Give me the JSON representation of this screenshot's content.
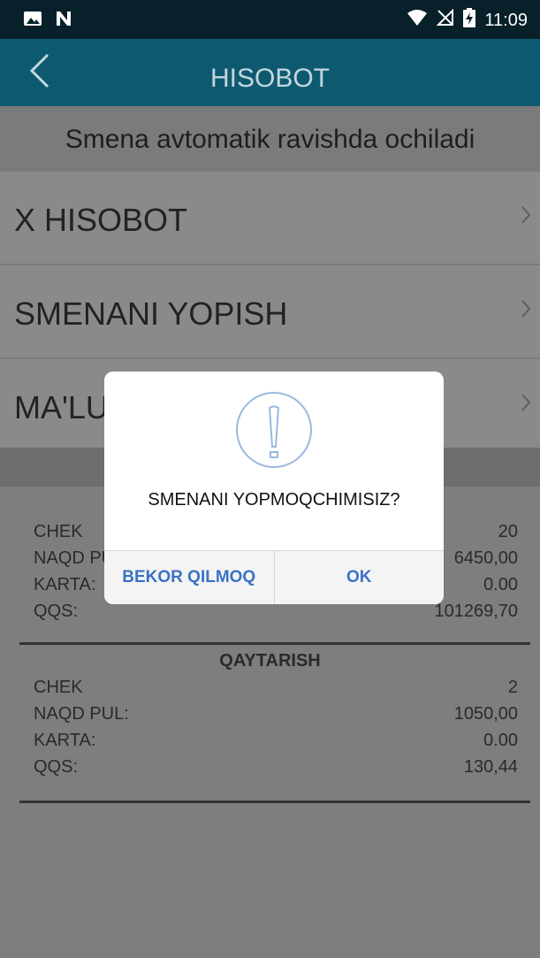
{
  "status_bar": {
    "time": "11:09",
    "left_icons": [
      "image-icon",
      "n-notification-icon"
    ],
    "right_icons": [
      "wifi-icon",
      "no-signal-icon",
      "battery-charging-icon"
    ]
  },
  "app_bar": {
    "title": "HISOBOT",
    "back_icon": "chevron-left-icon"
  },
  "subtitle": "Smena avtomatik ravishda ochiladi",
  "menu": {
    "items": [
      {
        "label": "X HISOBOT"
      },
      {
        "label": "SMENANI YOPISH"
      },
      {
        "label": "MA'LUMOTLARNI ..."
      }
    ]
  },
  "report": {
    "sales": {
      "rows": [
        {
          "label": "CHEK",
          "value": "20"
        },
        {
          "label": "NAQD PUL:",
          "value": "6450,00"
        },
        {
          "label": "KARTA:",
          "value": "0.00"
        },
        {
          "label": "QQS:",
          "value": "101269,70"
        }
      ]
    },
    "returns": {
      "title": "QAYTARISH",
      "rows": [
        {
          "label": "CHEK",
          "value": "2"
        },
        {
          "label": "NAQD PUL:",
          "value": "1050,00"
        },
        {
          "label": "KARTA:",
          "value": "0.00"
        },
        {
          "label": "QQS:",
          "value": "130,44"
        }
      ]
    }
  },
  "dialog": {
    "icon": "warning-icon",
    "message": "SMENANI YOPMOQCHIMISIZ?",
    "cancel_label": "BEKOR QILMOQ",
    "ok_label": "OK"
  },
  "colors": {
    "status_bar": "#07202a",
    "app_bar": "#0d5a70",
    "dialog_button_text": "#3a72c5",
    "warning_icon": "#9bb8e0"
  }
}
